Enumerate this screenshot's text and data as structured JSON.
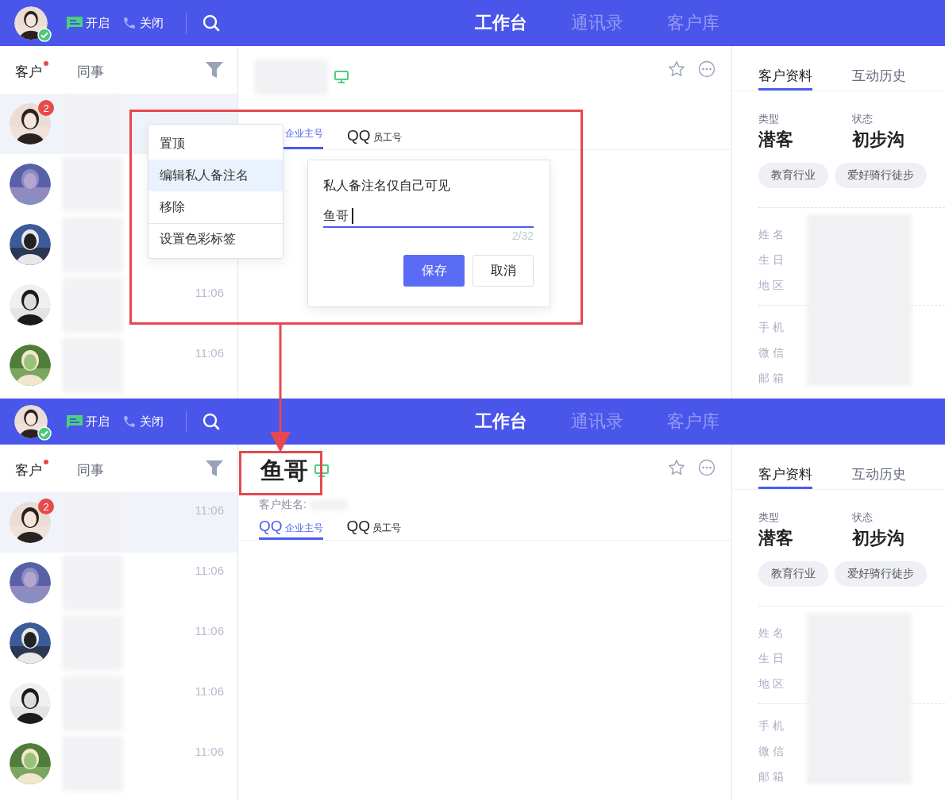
{
  "screens": [
    {
      "topbar": {
        "status_on": "开启",
        "status_off": "关闭",
        "nav": [
          {
            "label": "工作台",
            "selected": true
          },
          {
            "label": "通讯录",
            "selected": false
          },
          {
            "label": "客户库",
            "selected": false
          }
        ]
      },
      "sidebar": {
        "tabs": [
          {
            "label": "客户",
            "selected": true,
            "dot": true
          },
          {
            "label": "同事",
            "selected": false,
            "dot": false
          }
        ],
        "contacts": [
          {
            "selected": true,
            "badge": "2"
          },
          {
            "selected": false
          },
          {
            "selected": false
          },
          {
            "selected": false,
            "time": "11:06"
          },
          {
            "selected": false,
            "time": "11:06"
          }
        ]
      },
      "main": {
        "account_tabs": [
          {
            "sub": "企业主号",
            "selected": true
          },
          {
            "label": "QQ",
            "sub": "员工号",
            "selected": false
          }
        ]
      },
      "context_menu": {
        "items": [
          {
            "label": "置顶",
            "selected": false,
            "divider": false
          },
          {
            "label": "编辑私人备注名",
            "selected": true,
            "divider": false
          },
          {
            "label": "移除",
            "selected": false,
            "divider": false
          },
          {
            "label": "设置色彩标签",
            "selected": false,
            "divider": true
          }
        ]
      },
      "dialog": {
        "title": "私人备注名仅自己可见",
        "value": "鱼哥",
        "counter": "2/32",
        "buttons": [
          {
            "label": "保存",
            "kind": "primary"
          },
          {
            "label": "取消",
            "kind": "secondary"
          }
        ]
      },
      "profile": {
        "tabs": [
          {
            "label": "客户资料",
            "selected": true
          },
          {
            "label": "互动历史",
            "selected": false
          }
        ],
        "type_label": "类型",
        "type_value": "潜客",
        "status_label": "状态",
        "status_value": "初步沟",
        "tags": [
          "教育行业",
          "爱好骑行徒步"
        ],
        "fields": [
          [
            "姓 名",
            "生 日",
            "地 区"
          ],
          [
            "手 机",
            "微 信",
            "邮 箱"
          ]
        ]
      }
    },
    {
      "topbar": {
        "status_on": "开启",
        "status_off": "关闭",
        "nav": [
          {
            "label": "工作台",
            "selected": true
          },
          {
            "label": "通讯录",
            "selected": false
          },
          {
            "label": "客户库",
            "selected": false
          }
        ]
      },
      "sidebar": {
        "tabs": [
          {
            "label": "客户",
            "selected": true,
            "dot": true
          },
          {
            "label": "同事",
            "selected": false,
            "dot": false
          }
        ],
        "contacts": [
          {
            "selected": true,
            "badge": "2",
            "time": "11:06"
          },
          {
            "selected": false,
            "time": "11:06"
          },
          {
            "selected": false,
            "time": "11:06"
          },
          {
            "selected": false,
            "time": "11:06"
          },
          {
            "selected": false,
            "time": "11:06"
          }
        ]
      },
      "main": {
        "title": "鱼哥",
        "name_label": "客户姓名:",
        "account_tabs": [
          {
            "label": "QQ",
            "sub": "企业主号",
            "selected": true
          },
          {
            "label": "QQ",
            "sub": "员工号",
            "selected": false
          }
        ]
      },
      "profile": {
        "tabs": [
          {
            "label": "客户资料",
            "selected": true
          },
          {
            "label": "互动历史",
            "selected": false
          }
        ],
        "type_label": "类型",
        "type_value": "潜客",
        "status_label": "状态",
        "status_value": "初步沟",
        "tags": [
          "教育行业",
          "爱好骑行徒步"
        ],
        "fields": [
          [
            "姓 名",
            "生 日",
            "地 区"
          ],
          [
            "手 机",
            "微 信",
            "邮 箱"
          ]
        ]
      }
    }
  ],
  "annotations": [
    {
      "kind": "frame"
    },
    {
      "kind": "arrow"
    },
    {
      "kind": "frame"
    }
  ]
}
